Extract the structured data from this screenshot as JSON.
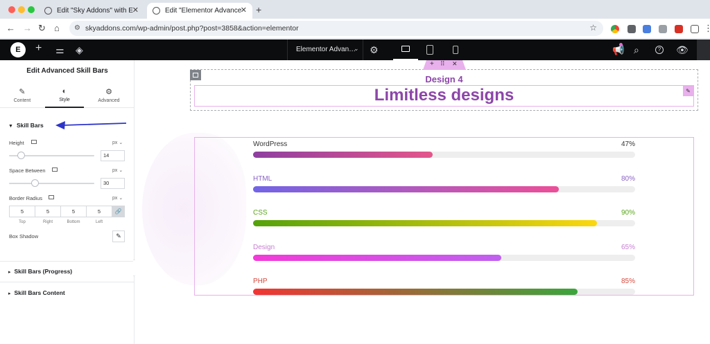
{
  "browser": {
    "tabs": [
      {
        "title": "Edit \"Sky Addons\" with Elementor",
        "active": false
      },
      {
        "title": "Edit \"Elementor Advanced Skill Bars\"",
        "active": true
      }
    ],
    "new_tab_label": "+",
    "url": "skyaddons.com/wp-admin/post.php?post=3858&action=elementor"
  },
  "editor_top": {
    "page_name": "Elementor Advan…",
    "logo_label": "E"
  },
  "panel": {
    "title": "Edit Advanced Skill Bars",
    "tabs": [
      {
        "label": "Content",
        "icon": "pencil-icon"
      },
      {
        "label": "Style",
        "icon": "half-circle-icon"
      },
      {
        "label": "Advanced",
        "icon": "gear-icon"
      }
    ],
    "active_tab": "Style",
    "sections": {
      "skill_bars": "Skill Bars",
      "skill_bars_progress": "Skill Bars (Progress)",
      "skill_bars_content": "Skill Bars Content"
    },
    "controls": {
      "height": {
        "label": "Height",
        "unit": "px",
        "value": "14"
      },
      "space_between": {
        "label": "Space Between",
        "unit": "px",
        "value": "30"
      },
      "border_radius": {
        "label": "Border Radius",
        "unit": "px",
        "values": [
          "5",
          "5",
          "5",
          "5"
        ],
        "sides": [
          "Top",
          "Right",
          "Bottom",
          "Left"
        ]
      },
      "box_shadow": {
        "label": "Box Shadow"
      }
    }
  },
  "canvas": {
    "subtitle": "Design 4",
    "heading": "Limitless designs",
    "skills": [
      {
        "name": "WordPress",
        "percent": "47%",
        "value": 0.47,
        "from": "#8e3fa0",
        "to": "#e4568c",
        "label_color": "#333333"
      },
      {
        "name": "HTML",
        "percent": "80%",
        "value": 0.8,
        "from": "#7264e6",
        "to": "#ec4f98",
        "label_color": "#8a62c4"
      },
      {
        "name": "CSS",
        "percent": "90%",
        "value": 0.9,
        "from": "#55a20b",
        "to": "#fbd70f",
        "label_color": "#5aa51b"
      },
      {
        "name": "Design",
        "percent": "65%",
        "value": 0.65,
        "from": "#f23ad8",
        "to": "#c060f0",
        "label_color": "#c77fd2"
      },
      {
        "name": "PHP",
        "percent": "85%",
        "value": 0.85,
        "from": "#f23532",
        "to": "#3aa63b",
        "label_color": "#d64a3f"
      }
    ]
  },
  "colors": {
    "accent_purple": "#8c46a9",
    "selection_pink": "#e8b0ec",
    "arrow_blue": "#2d35c9"
  }
}
